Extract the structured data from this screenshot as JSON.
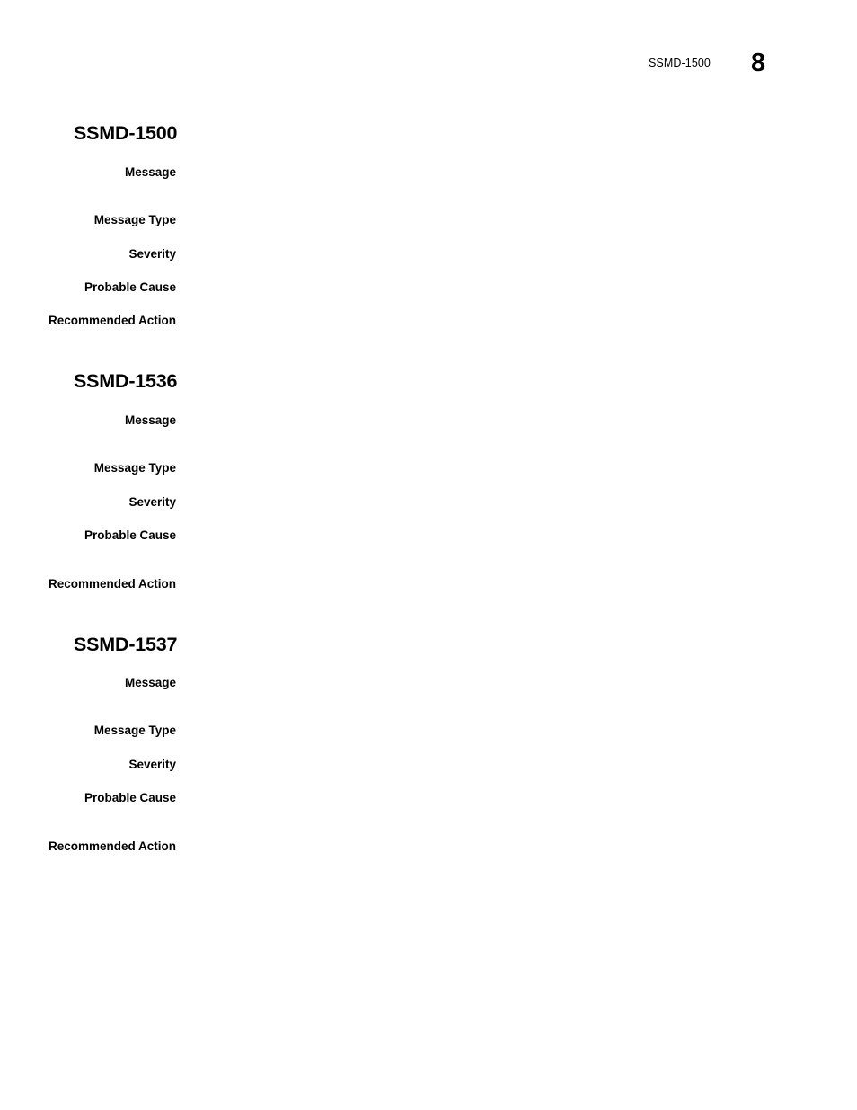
{
  "document": {
    "page_background": "#ffffff",
    "text_color": "#000000"
  },
  "header": {
    "chapter_title": "SSMD-1500",
    "page_number": "8"
  },
  "labels": {
    "message": "Message",
    "message_type": "Message Type",
    "severity": "Severity",
    "probable_cause": "Probable Cause",
    "recommended_action": "Recommended Action"
  },
  "sections": [
    {
      "heading": "SSMD-1500",
      "fields": [
        {
          "label": "Message",
          "value": ""
        },
        {
          "label": "Message Type",
          "value": ""
        },
        {
          "label": "Severity",
          "value": ""
        },
        {
          "label": "Probable Cause",
          "value": ""
        },
        {
          "label": "Recommended Action",
          "value": ""
        }
      ]
    },
    {
      "heading": "SSMD-1536",
      "fields": [
        {
          "label": "Message",
          "value": ""
        },
        {
          "label": "Message Type",
          "value": ""
        },
        {
          "label": "Severity",
          "value": ""
        },
        {
          "label": "Probable Cause",
          "value": ""
        },
        {
          "label": "Recommended Action",
          "value": ""
        }
      ]
    },
    {
      "heading": "SSMD-1537",
      "fields": [
        {
          "label": "Message",
          "value": ""
        },
        {
          "label": "Message Type",
          "value": ""
        },
        {
          "label": "Severity",
          "value": ""
        },
        {
          "label": "Probable Cause",
          "value": ""
        },
        {
          "label": "Recommended Action",
          "value": ""
        }
      ]
    }
  ]
}
